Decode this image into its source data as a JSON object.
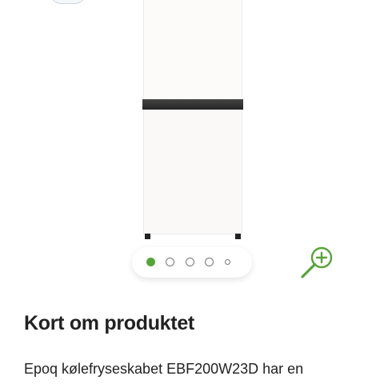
{
  "gallery": {
    "image": "fridge-freezer-white",
    "dots": [
      {
        "state": "active"
      },
      {
        "state": "inactive"
      },
      {
        "state": "inactive"
      },
      {
        "state": "inactive"
      },
      {
        "state": "inactive-small"
      }
    ],
    "zoom_icon": "zoom-in-icon",
    "accent_color": "#57a43a"
  },
  "section": {
    "title": "Kort om produktet",
    "text": "Epoq kølefryseskabet EBF200W23D har en"
  }
}
